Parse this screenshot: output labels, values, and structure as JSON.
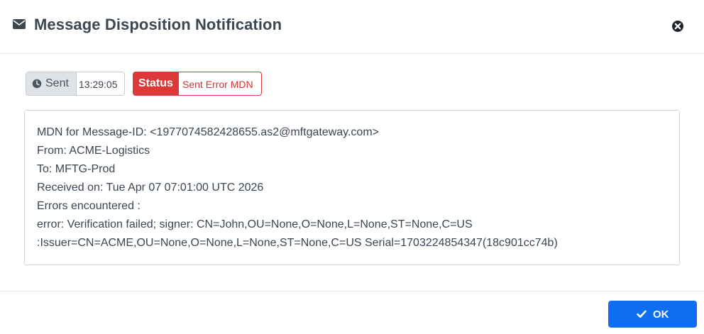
{
  "dialog": {
    "title": "Message Disposition Notification",
    "title_icon": "envelope-icon",
    "close_icon": "close-circle-icon"
  },
  "badges": {
    "sent_label": "Sent",
    "sent_icon": "clock-icon",
    "sent_time": "13:29:05",
    "status_label": "Status",
    "status_value": "Sent Error MDN",
    "status_color": "#dc3a3a"
  },
  "mdn": {
    "lines": [
      "MDN for Message-ID: <1977074582428655.as2@mftgateway.com>",
      "From: ACME-Logistics",
      "To: MFTG-Prod",
      "Received on: Tue Apr 07 07:01:00 UTC 2026",
      "Errors encountered :",
      "error: Verification failed; signer: CN=John,OU=None,O=None,L=None,ST=None,C=US",
      ":Issuer=CN=ACME,OU=None,O=None,L=None,ST=None,C=US Serial=1703224854347(18c901cc74b)"
    ]
  },
  "footer": {
    "ok_label": "OK",
    "ok_icon": "check-icon",
    "ok_color": "#0d6ef0"
  }
}
